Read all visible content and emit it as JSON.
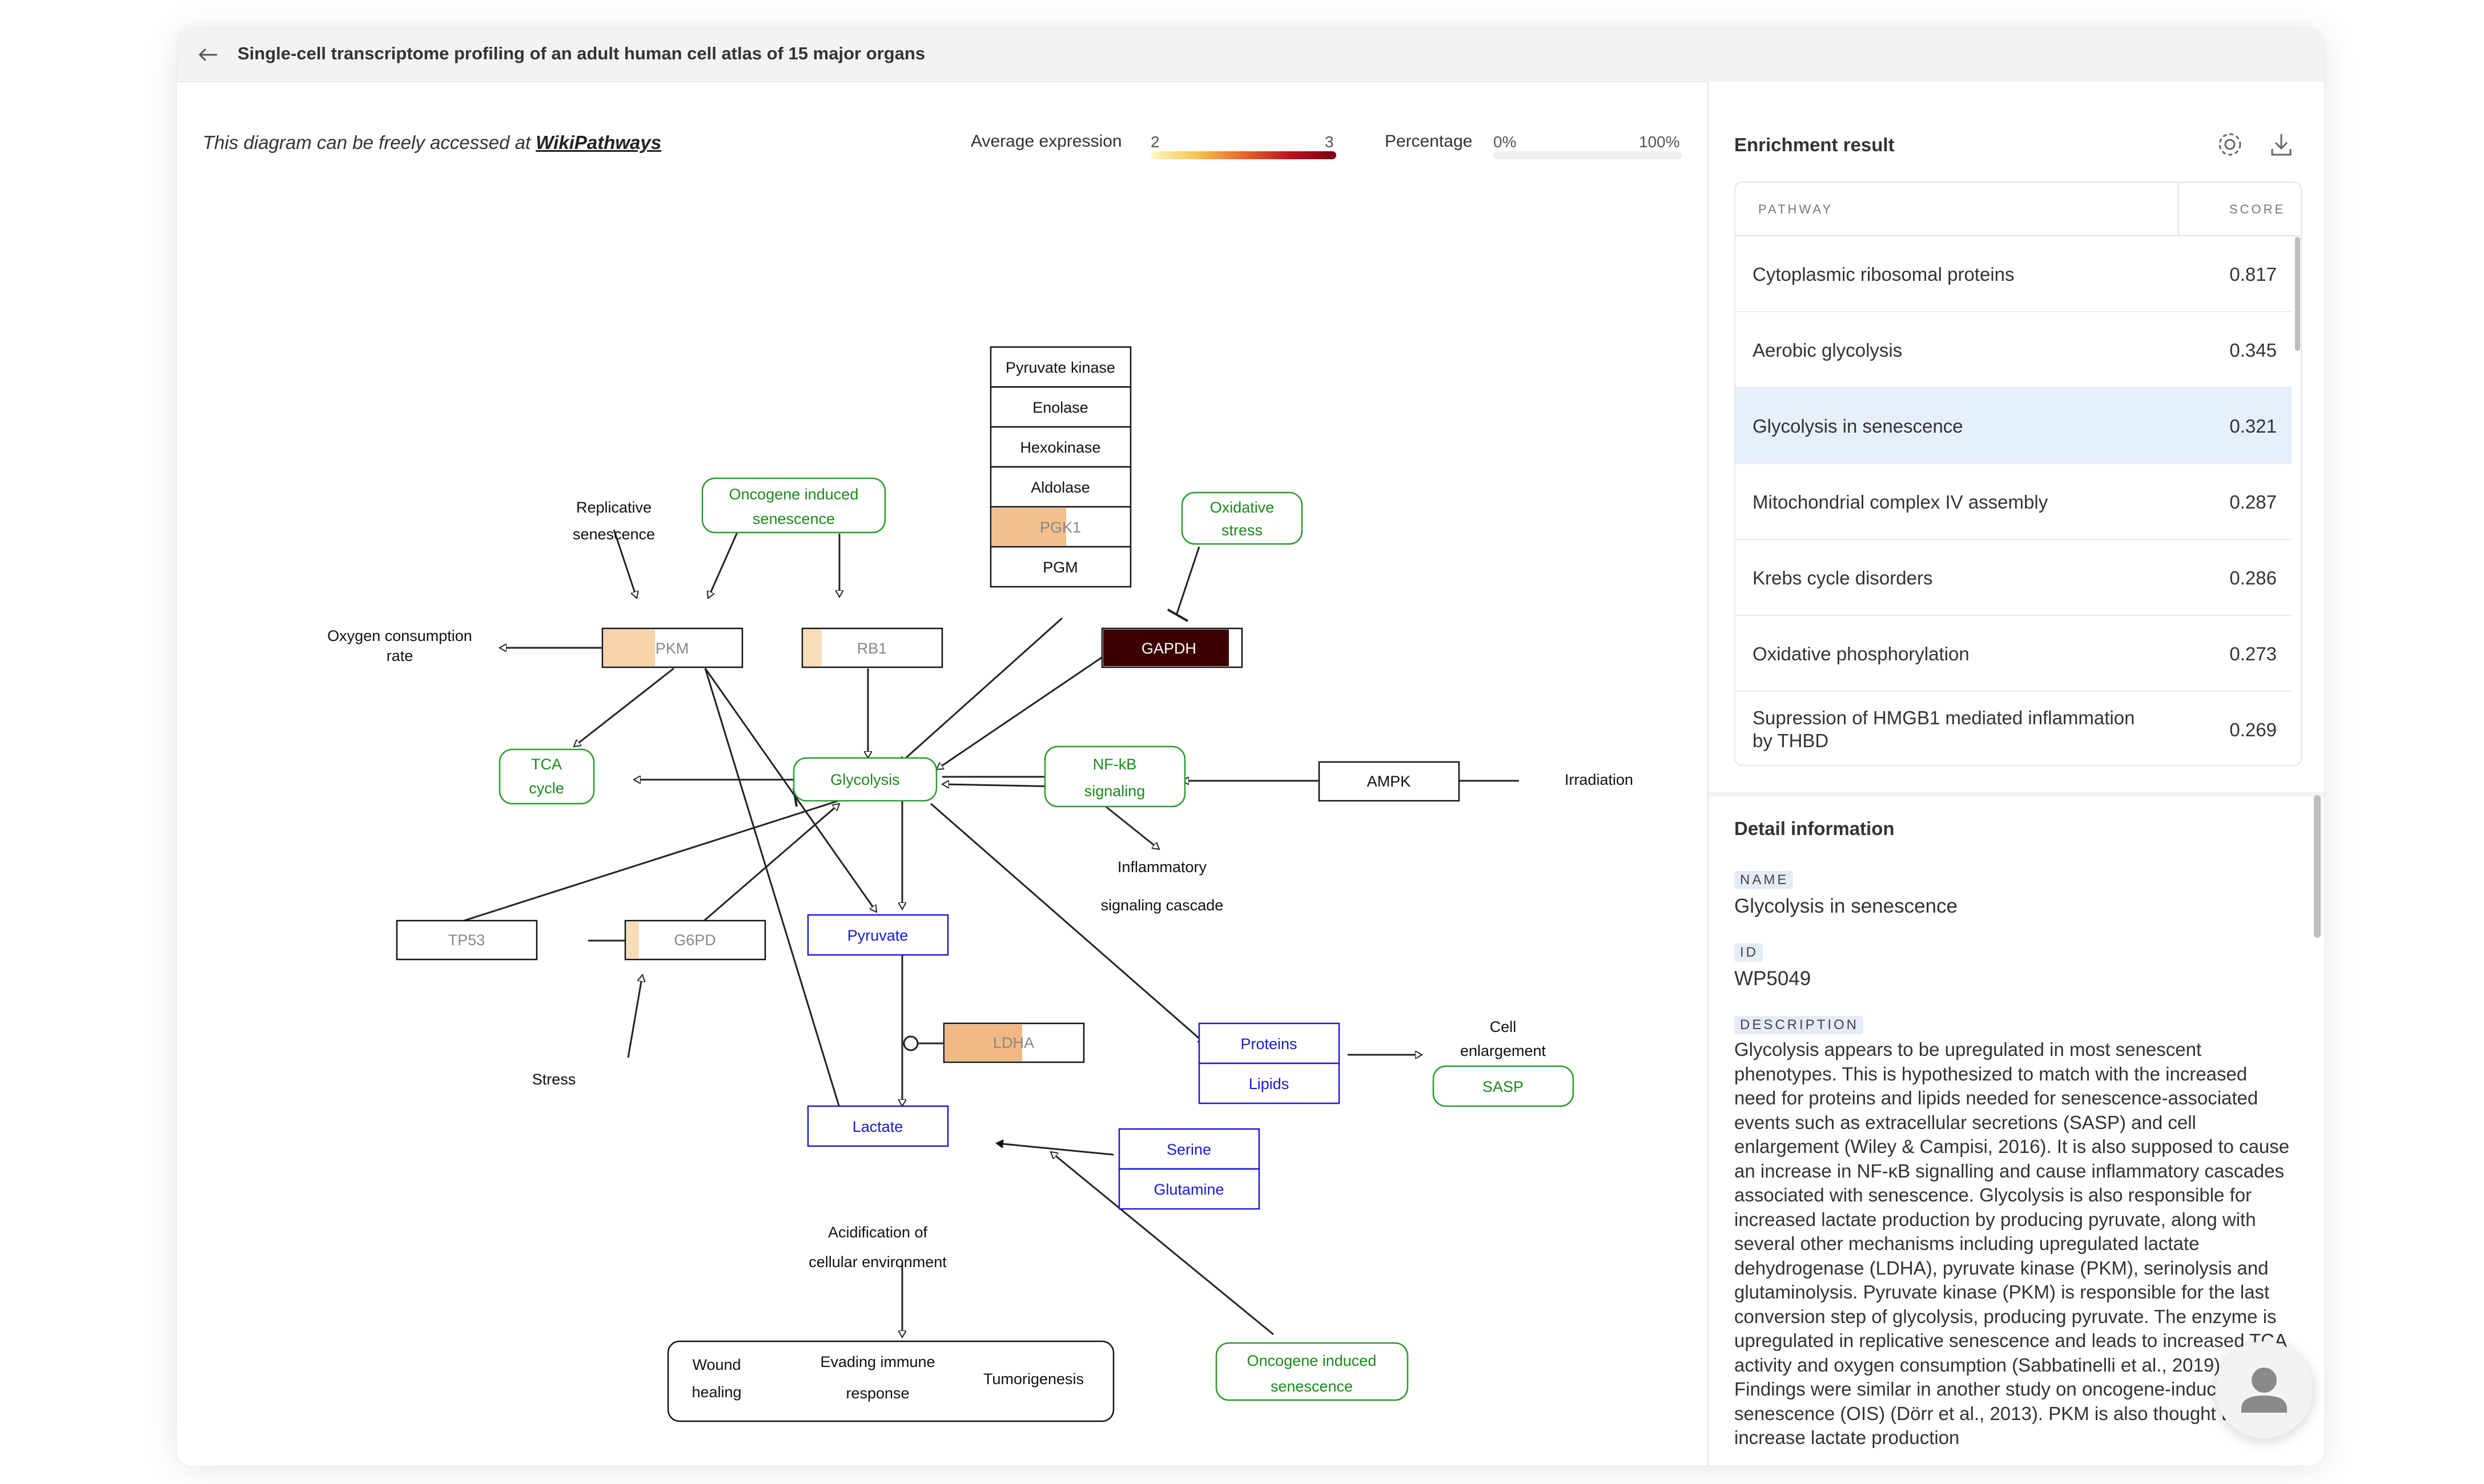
{
  "header": {
    "title": "Single-cell transcriptome profiling of an adult human cell atlas of 15 major organs"
  },
  "notice": {
    "prefix": "This diagram can be freely accessed at",
    "link": "WikiPathways"
  },
  "legend": {
    "expression_label": "Average expression",
    "expression_min": "2",
    "expression_max": "3",
    "percentage_label": "Percentage",
    "percentage_min": "0%",
    "percentage_max": "100%",
    "colors": [
      "#fff7c2",
      "#f7c34e",
      "#e8642a",
      "#c0131e",
      "#7a0010"
    ]
  },
  "diagram": {
    "enzymes": [
      "Pyruvate kinase",
      "Enolase",
      "Hexokinase",
      "Aldolase",
      "PGK1",
      "PGM"
    ],
    "genes": {
      "pkm": "PKM",
      "rb1": "RB1",
      "gapdh": "GAPDH",
      "tp53": "TP53",
      "g6pd": "G6PD",
      "ldha": "LDHA",
      "ampk": "AMPK"
    },
    "green_nodes": {
      "oncogene_top_1": "Oncogene induced",
      "oncogene_top_2": "senescence",
      "oxidative_1": "Oxidative",
      "oxidative_2": "stress",
      "tca_1": "TCA",
      "tca_2": "cycle",
      "glycolysis": "Glycolysis",
      "nfkb_1": "NF-kB",
      "nfkb_2": "signaling",
      "sasp": "SASP",
      "oncogene_bottom_1": "Oncogene induced",
      "oncogene_bottom_2": "senescence"
    },
    "blue_nodes": {
      "pyruvate": "Pyruvate",
      "proteins": "Proteins",
      "lipids": "Lipids",
      "lactate": "Lactate",
      "serine": "Serine",
      "glutamine": "Glutamine"
    },
    "labels": {
      "replicative_1": "Replicative",
      "replicative_2": "senescence",
      "oxygen_1": "Oxygen consumption",
      "oxygen_2": "rate",
      "irradiation": "Irradiation",
      "inflammatory_1": "Inflammatory",
      "inflammatory_2": "signaling cascade",
      "cell_enlargement_1": "Cell",
      "cell_enlargement_2": "enlargement",
      "stress": "Stress",
      "acidification_1": "Acidification of",
      "acidification_2": "cellular environment"
    },
    "outcomes": {
      "wound_1": "Wound",
      "wound_2": "healing",
      "evading_1": "Evading immune",
      "evading_2": "response",
      "tumorigenesis": "Tumorigenesis"
    }
  },
  "enrichment": {
    "title": "Enrichment result",
    "columns": [
      "PATHWAY",
      "SCORE"
    ],
    "rows": [
      {
        "pathway": "Cytoplasmic ribosomal proteins",
        "score": "0.817"
      },
      {
        "pathway": "Aerobic glycolysis",
        "score": "0.345"
      },
      {
        "pathway": "Glycolysis in senescence",
        "score": "0.321",
        "selected": true
      },
      {
        "pathway": "Mitochondrial complex IV assembly",
        "score": "0.287"
      },
      {
        "pathway": "Krebs cycle disorders",
        "score": "0.286"
      },
      {
        "pathway": "Oxidative phosphorylation",
        "score": "0.273"
      },
      {
        "pathway": "Supression of HMGB1 mediated inflammation by THBD",
        "score": "0.269"
      }
    ]
  },
  "detail": {
    "title": "Detail information",
    "name_label": "NAME",
    "name": "Glycolysis in senescence",
    "id_label": "ID",
    "id": "WP5049",
    "description_label": "DESCRIPTION",
    "description": "Glycolysis appears to be upregulated in most senescent phenotypes. This is hypothesized to match with the increased need for proteins and lipids needed for senescence-associated events such as extracellular secretions (SASP) and cell enlargement (Wiley & Campisi, 2016). It is also supposed to cause an increase in NF-κB signalling and cause inflammatory cascades associated with senescence. Glycolysis is also responsible for increased lactate production by producing pyruvate, along with several other mechanisms including upregulated lactate dehydrogenase (LDHA), pyruvate kinase (PKM), serinolysis and glutaminolysis. Pyruvate kinase (PKM) is responsible for the last conversion step of glycolysis, producing pyruvate. The enzyme is upregulated in replicative senescence and leads to increased TCA activity and oxygen consumption (Sabbatinelli et al., 2019). Findings were similar in another study on oncogene-induced senescence (OIS) (Dörr et al., 2013). PKM is also thought to increase lactate production"
  }
}
